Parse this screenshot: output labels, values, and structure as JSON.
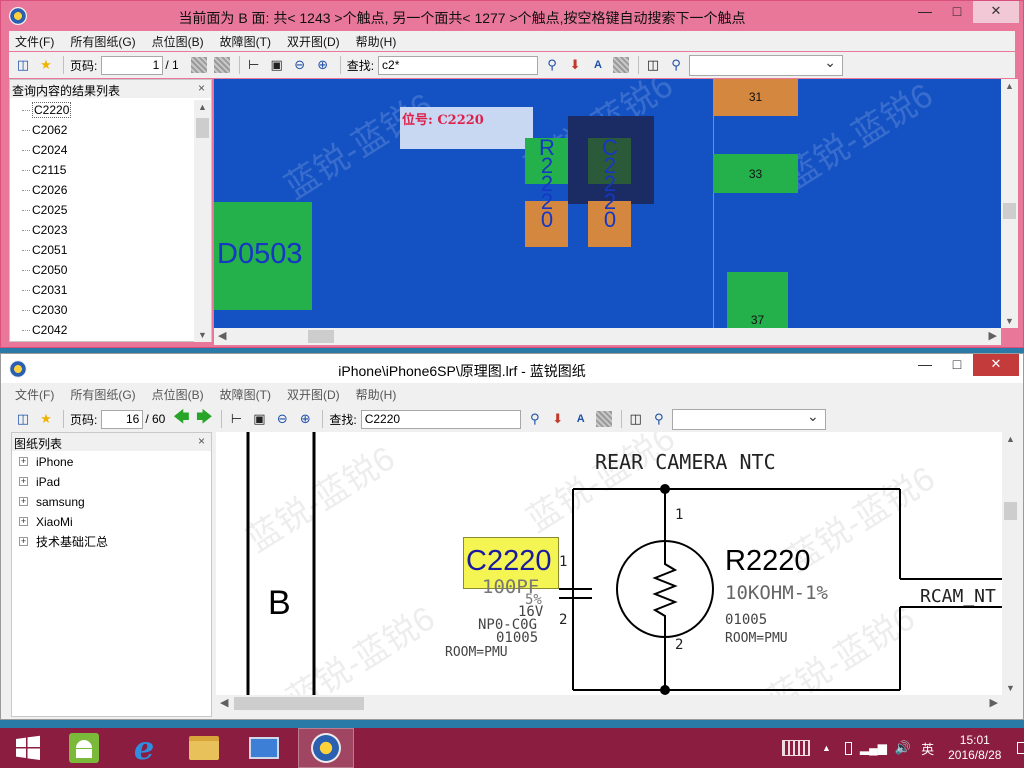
{
  "top_window": {
    "title": "当前面为 B 面: 共< 1243 >个触点, 另一个面共< 1277 >个触点,按空格键自动搜索下一个触点",
    "menu": [
      "文件(F)",
      "所有图纸(G)",
      "点位图(B)",
      "故障图(T)",
      "双开图(D)",
      "帮助(H)"
    ],
    "page_label": "页码:",
    "page_current": "1",
    "page_total": "/ 1",
    "search_label": "查找:",
    "search_value": "c2*",
    "panel_title": "查询内容的结果列表",
    "results": [
      "C2220",
      "C2062",
      "C2024",
      "C2115",
      "C2026",
      "C2025",
      "C2023",
      "C2051",
      "C2050",
      "C2031",
      "C2030",
      "C2042"
    ],
    "canvas": {
      "position_label": "位号: C2220",
      "component_big": "D0503",
      "pad_31": "31",
      "pad_33": "33",
      "pad_37": "37",
      "col_r": [
        "R",
        "2",
        "2",
        "2",
        "0"
      ],
      "col_c": [
        "C",
        "2",
        "2",
        "2",
        "0"
      ],
      "watermark": "蓝锐-蓝锐6"
    }
  },
  "bottom_window": {
    "title": "iPhone\\iPhone6SP\\原理图.lrf - 蓝锐图纸",
    "menu": [
      "文件(F)",
      "所有图纸(G)",
      "点位图(B)",
      "故障图(T)",
      "双开图(D)",
      "帮助(H)"
    ],
    "page_label": "页码:",
    "page_current": "16",
    "page_total": "/ 60",
    "search_label": "查找:",
    "search_value": "C2220",
    "panel_title": "图纸列表",
    "tree": [
      "iPhone",
      "iPad",
      "samsung",
      "XiaoMi",
      "技术基础汇总"
    ],
    "schematic": {
      "title": "REAR CAMERA NTC",
      "bus_label": "B",
      "cap_ref": "C2220",
      "cap_value": "100PF",
      "cap_tol": "5%",
      "cap_volt": "16V",
      "cap_type": "NP0-C0G",
      "cap_size": "01005",
      "cap_room": "ROOM=PMU",
      "res_ref": "R2220",
      "res_value": "10KOHM-1%",
      "res_size": "01005",
      "res_room": "ROOM=PMU",
      "pin1_cap": "1",
      "pin2_cap": "2",
      "pin1_res": "1",
      "pin2_res": "2",
      "net_label": "RCAM_NT",
      "watermark": "蓝锐-蓝锐6"
    }
  },
  "taskbar": {
    "ime": "英",
    "time": "15:01",
    "date": "2016/8/28"
  },
  "colors": {
    "top_titlebar": "#e9779a",
    "pcb_background": "#1452c4",
    "pad_orange": "#d3873f",
    "pad_green": "#24b04a",
    "highlight_yellow": "#f4f452",
    "taskbar": "#8b1d40"
  }
}
